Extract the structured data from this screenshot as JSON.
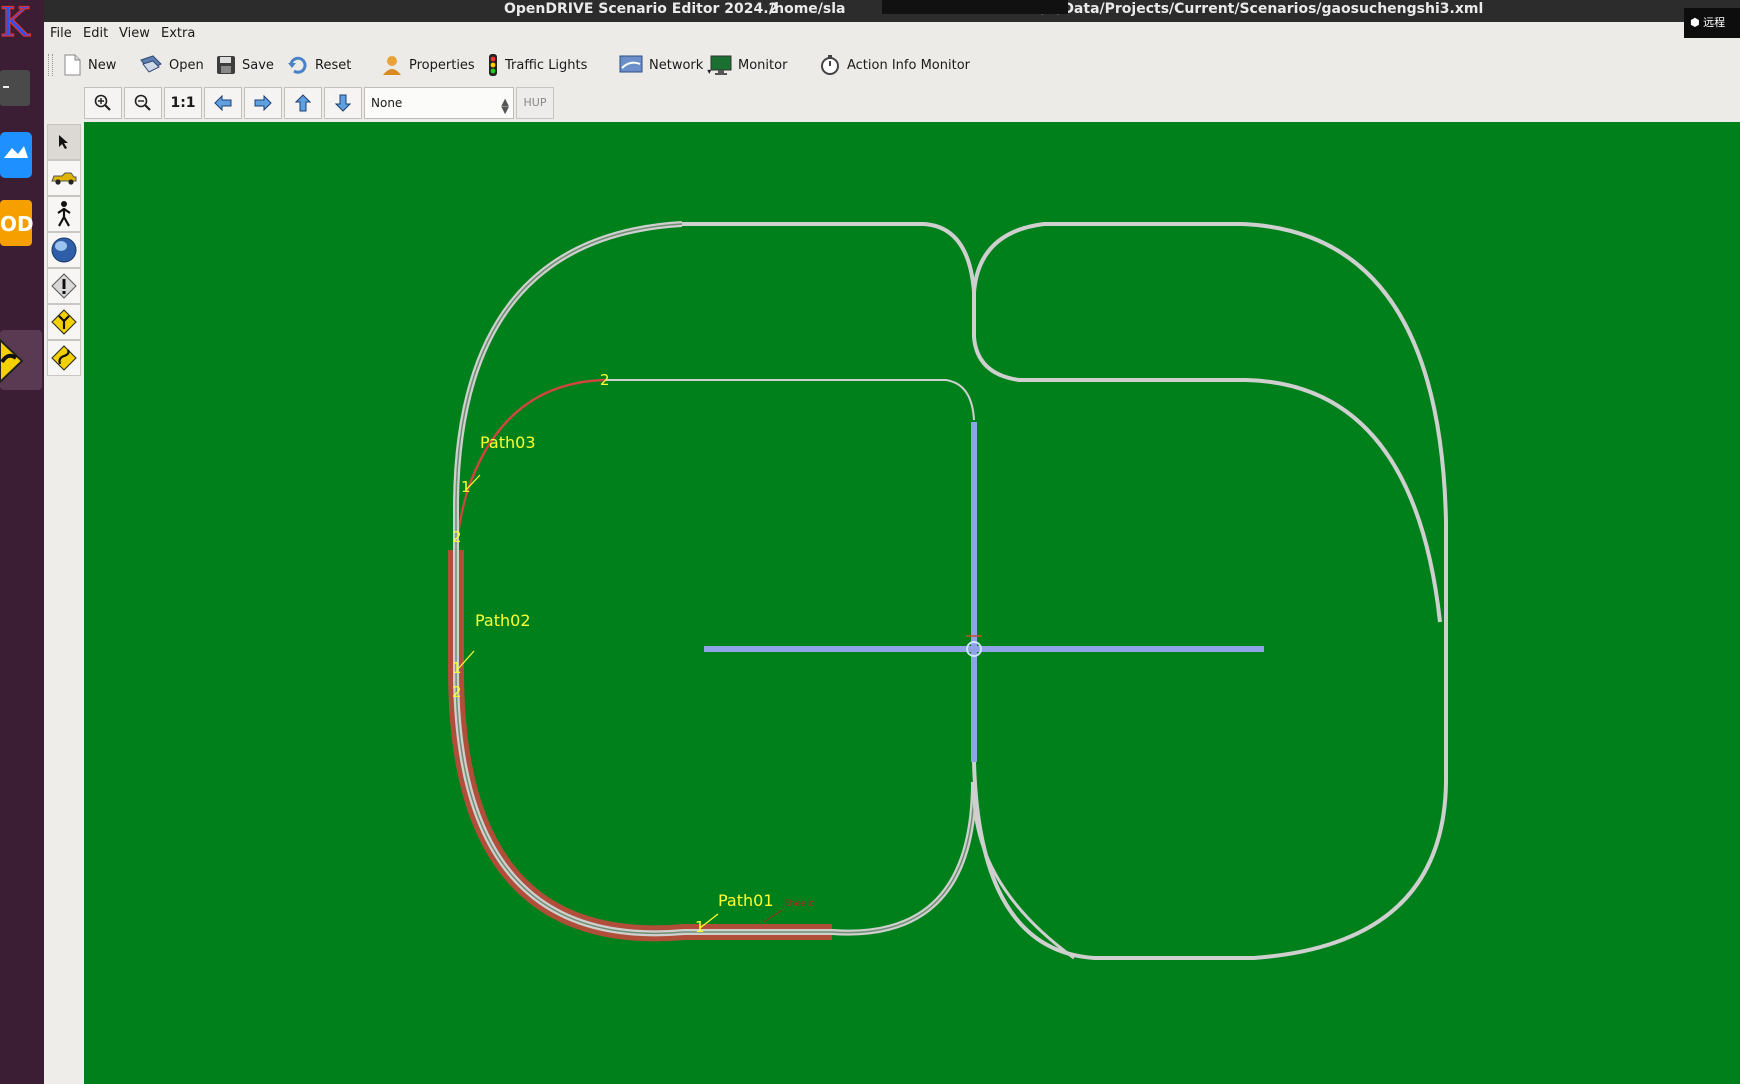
{
  "window": {
    "title": "OpenDRIVE Scenario Editor 2024.2",
    "path_start": "/home/sla",
    "path_end": "n/../Data/Projects/Current/Scenarios/gaosuchengshi3.xml",
    "remote_badge": "远程"
  },
  "launcher": {
    "od_label": "OD"
  },
  "menu": {
    "file": "File",
    "edit": "Edit",
    "view": "View",
    "extra": "Extra"
  },
  "toolbar": {
    "new": "New",
    "open": "Open",
    "save": "Save",
    "reset": "Reset",
    "properties": "Properties",
    "traffic_lights": "Traffic Lights",
    "network": "Network",
    "monitor": "Monitor",
    "action_info_monitor": "Action Info Monitor"
  },
  "navbar": {
    "zoom_reset": "1:1",
    "select_value": "None",
    "hup": "HUP"
  },
  "palette": {
    "tools": [
      "select-tool",
      "vehicle-tool",
      "pedestrian-tool",
      "environment-tool",
      "warning-tool",
      "junction-tool",
      "curve-tool"
    ]
  },
  "canvas": {
    "background": "#00801a",
    "path_labels": [
      {
        "name": "Path01",
        "start": "1"
      },
      {
        "name": "Path02",
        "start": "1",
        "end_a": "2",
        "end_b": "2"
      },
      {
        "name": "Path03",
        "start": "1",
        "end": "2"
      }
    ],
    "small_marker": "Eheelo"
  },
  "colors": {
    "road": "#c9c9c9",
    "path_highlight": "#d0453f",
    "junction_road": "#8fa3e6",
    "label": "#ffff33"
  }
}
